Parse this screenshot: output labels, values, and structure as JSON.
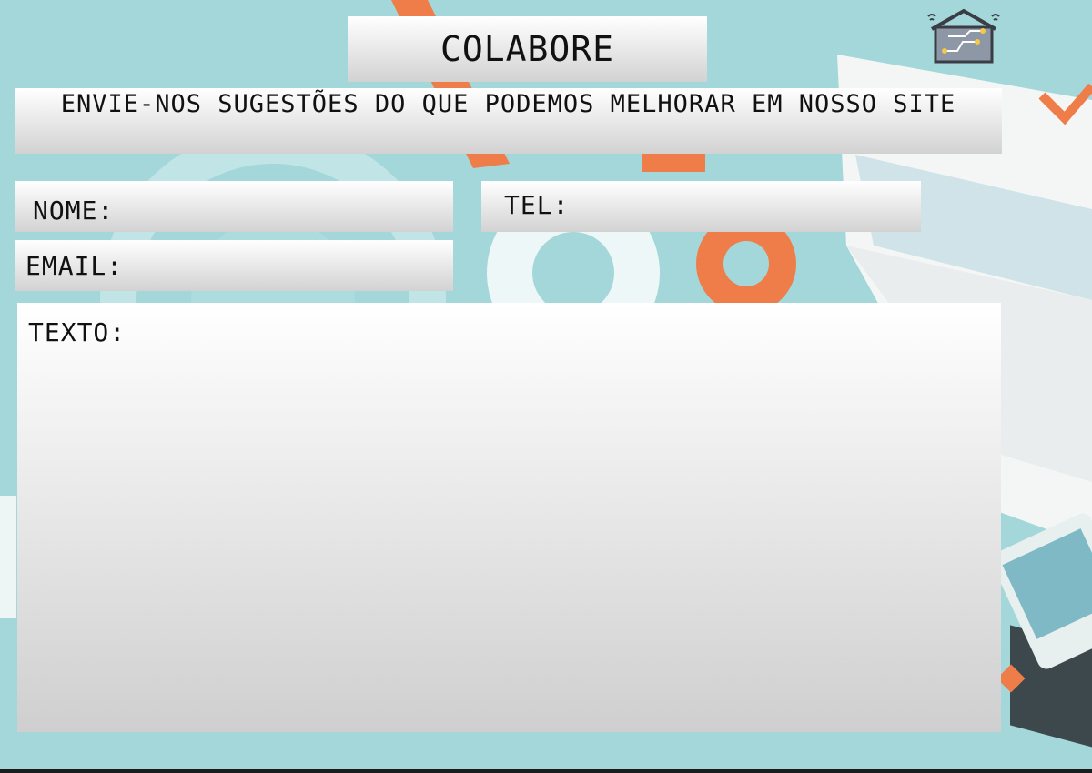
{
  "header": {
    "title": "COLABORE",
    "subtitle": "ENVIE-NOS SUGESTÕES DO QUE PODEMOS MELHORAR EM NOSSO SITE"
  },
  "form": {
    "nome_label": "NOME:",
    "tel_label": "TEL:",
    "email_label": "EMAIL:",
    "texto_label": "TEXTO:"
  },
  "logo": {
    "icon": "smart-home-icon"
  },
  "colors": {
    "background": "#9fd3d6",
    "accent_orange": "#ef7d4a",
    "panel_top": "#ffffff",
    "panel_bottom": "#d2d2d2"
  }
}
